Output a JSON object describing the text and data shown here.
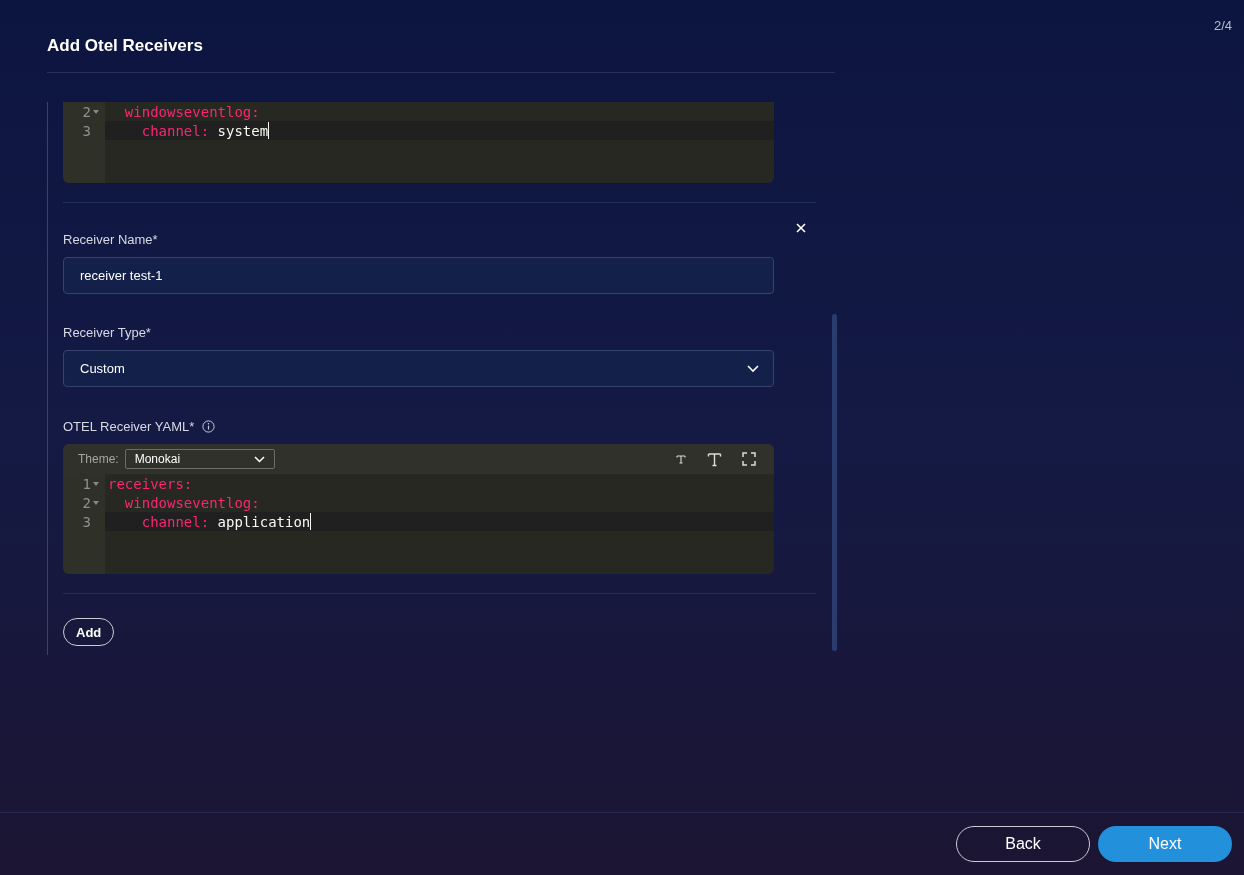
{
  "step": "2/4",
  "title": "Add Otel Receivers",
  "receivers": [
    {
      "kind": "partial",
      "editor": {
        "lines": [
          {
            "number": "2",
            "foldable": true,
            "active": false,
            "key": "  windowseventlog:"
          },
          {
            "number": "3",
            "foldable": false,
            "active": true,
            "key": "    channel:",
            "value": " system"
          }
        ]
      }
    },
    {
      "kind": "full",
      "name_label": "Receiver Name*",
      "name_value": "receiver test-1",
      "type_label": "Receiver Type*",
      "type_value": "Custom",
      "yaml_label": "OTEL Receiver YAML*",
      "editor": {
        "theme_label": "Theme:",
        "theme_value": "Monokai",
        "lines": [
          {
            "number": "1",
            "foldable": true,
            "active": false,
            "key": "receivers:"
          },
          {
            "number": "2",
            "foldable": true,
            "active": false,
            "key": "  windowseventlog:"
          },
          {
            "number": "3",
            "foldable": false,
            "active": true,
            "key": "    channel:",
            "value": " application"
          }
        ]
      }
    }
  ],
  "add_button": "Add",
  "buttons": {
    "back": "Back",
    "next": "Next"
  }
}
